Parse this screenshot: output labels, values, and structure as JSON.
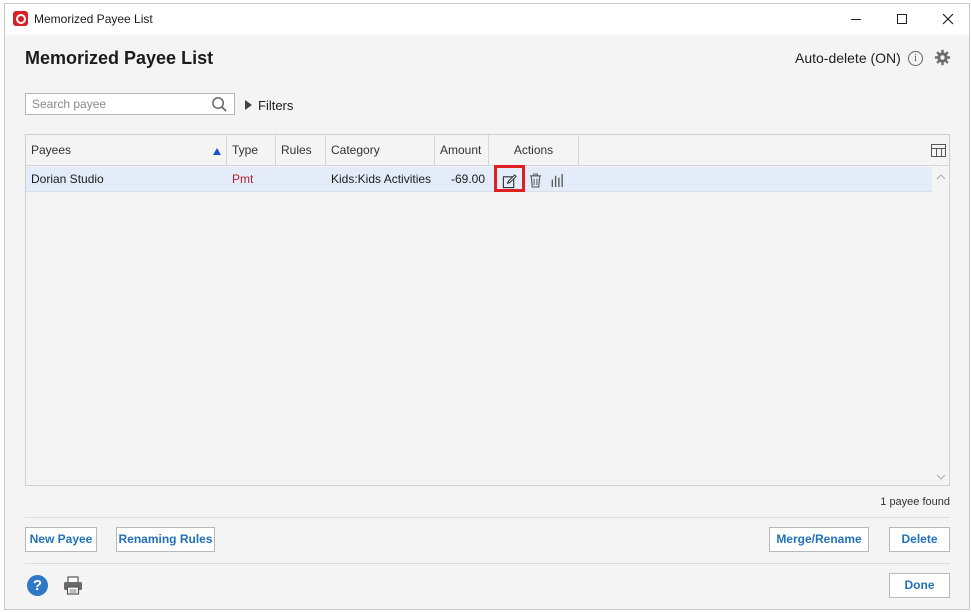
{
  "window": {
    "title": "Memorized Payee List"
  },
  "page": {
    "heading": "Memorized Payee List",
    "auto_delete_label": "Auto-delete (ON)",
    "info_glyph": "i"
  },
  "search": {
    "placeholder": "Search payee",
    "value": ""
  },
  "filters": {
    "label": "Filters"
  },
  "table": {
    "columns": [
      "Payees",
      "Type",
      "Rules",
      "Category",
      "Amount",
      "Actions"
    ],
    "sort_column": "Payees",
    "sort_direction": "ascending",
    "rows": [
      {
        "payee": "Dorian Studio",
        "type": "Pmt",
        "rules": "",
        "category": "Kids:Kids Activities",
        "amount": "-69.00",
        "actions": [
          "edit-icon",
          "trash-icon",
          "report-icon"
        ]
      }
    ],
    "highlighted_action": "edit-icon"
  },
  "status": {
    "count_text": "1 payee found"
  },
  "buttons": {
    "new_payee": "New Payee",
    "renaming_rules": "Renaming Rules",
    "merge_rename": "Merge/Rename",
    "delete": "Delete",
    "done": "Done"
  },
  "footer": {
    "help_glyph": "?"
  },
  "colors": {
    "accent": "#2372b9",
    "payment_type": "#b3202c",
    "selected_row": "#e3ecf8",
    "highlight": "#e01f1f",
    "brand": "#d6202a"
  }
}
